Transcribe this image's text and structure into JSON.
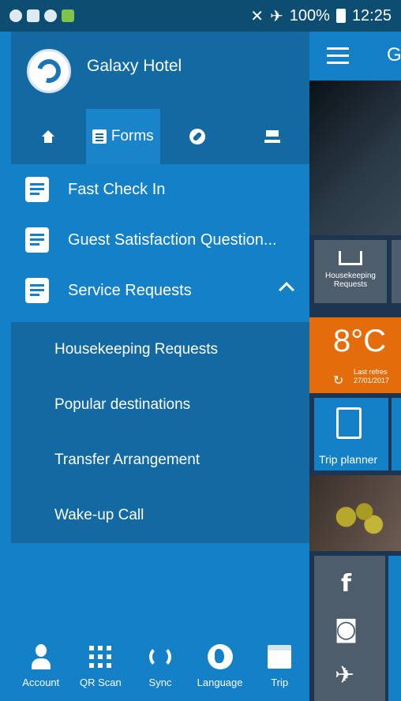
{
  "status_bar": {
    "battery": "100%",
    "time": "12:25"
  },
  "background_app": {
    "title_initial": "G",
    "tile_housekeeping": "Housekeeping Requests",
    "weather": {
      "temp": "8°C",
      "last_refresh": "Last refres",
      "date": "27/01/2017"
    },
    "trip_planner": "Trip planner"
  },
  "drawer": {
    "hotel_name": "Galaxy Hotel",
    "tabs": [
      {
        "label": ""
      },
      {
        "label": "Forms"
      },
      {
        "label": ""
      },
      {
        "label": ""
      }
    ],
    "forms": [
      {
        "label": "Fast Check In"
      },
      {
        "label": "Guest Satisfaction Question..."
      },
      {
        "label": "Service Requests"
      }
    ],
    "service_requests": [
      {
        "label": "Housekeeping Requests"
      },
      {
        "label": "Popular destinations"
      },
      {
        "label": "Transfer Arrangement"
      },
      {
        "label": "Wake-up Call"
      }
    ],
    "bottom_nav": [
      {
        "label": "Account"
      },
      {
        "label": "QR Scan"
      },
      {
        "label": "Sync"
      },
      {
        "label": "Language"
      },
      {
        "label": "Trip"
      }
    ]
  }
}
